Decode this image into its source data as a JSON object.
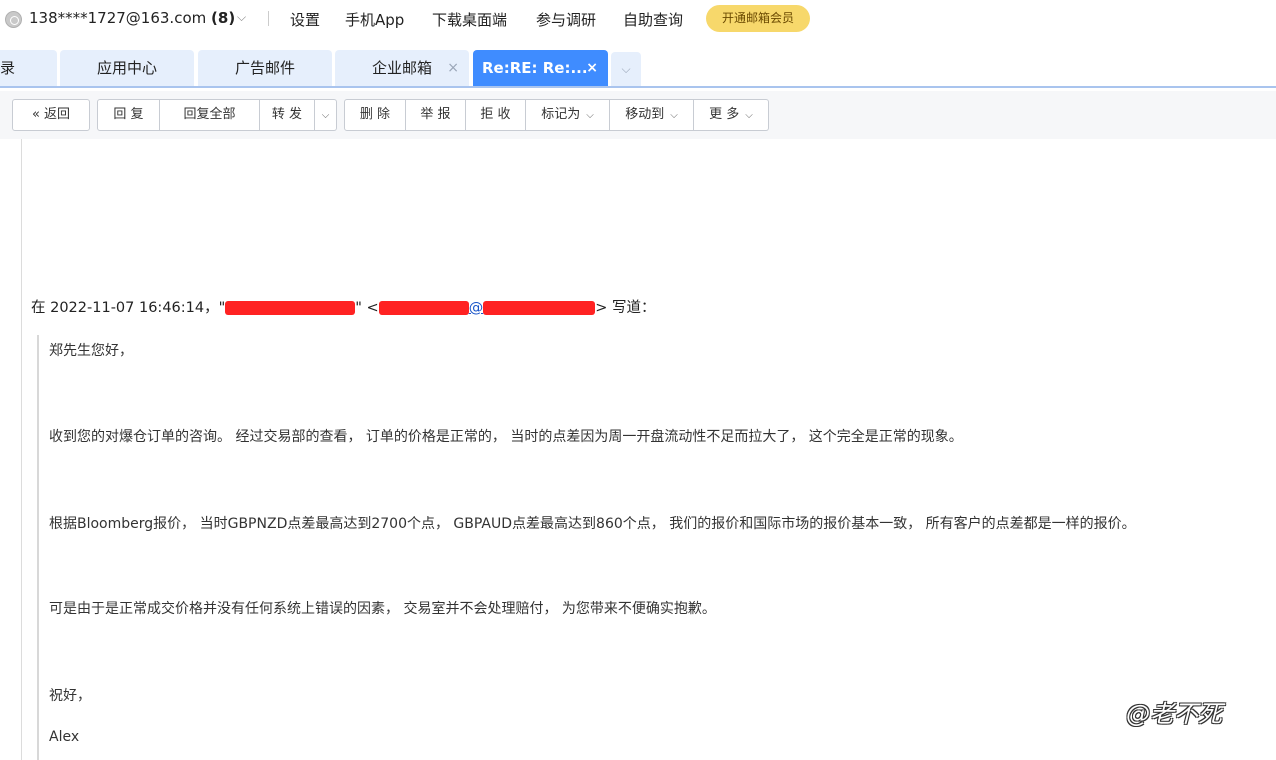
{
  "header": {
    "account_email": "138****1727@163.com",
    "account_unread": "(8)",
    "links": [
      "设置",
      "手机App",
      "下载桌面端",
      "参与调研",
      "自助查询"
    ],
    "vip_label": "开通邮箱会员",
    "vip_color": "#f7d86b"
  },
  "tabs": [
    {
      "label": "录"
    },
    {
      "label": "应用中心"
    },
    {
      "label": "广告邮件"
    },
    {
      "label": "企业邮箱"
    },
    {
      "label": "Re:RE: Re:..."
    }
  ],
  "tab_close_glyph": "×",
  "toolbar": {
    "back": "返回",
    "reply": "回 复",
    "reply_all": "回复全部",
    "forward": "转 发",
    "delete": "删 除",
    "report": "举 报",
    "reject": "拒 收",
    "mark_as": "标记为",
    "move_to": "移动到",
    "more": "更 多"
  },
  "email": {
    "quote_header_prefix": "在 2022-11-07 16:46:14，\"",
    "quote_header_mid": "\" <",
    "quote_header_at": "@",
    "quote_header_suffix": "> 写道：",
    "greeting": "郑先生您好，",
    "para1": "收到您的对爆仓订单的咨询。 经过交易部的查看， 订单的价格是正常的， 当时的点差因为周一开盘流动性不足而拉大了， 这个完全是正常的现象。",
    "para2": "根据Bloomberg报价， 当时GBPNZD点差最高达到2700个点， GBPAUD点差最高达到860个点， 我们的报价和国际市场的报价基本一致， 所有客户的点差都是一样的报价。",
    "para3": "可是由于是正常成交价格并没有任何系统上错误的因素， 交易室并不会处理赔付， 为您带来不便确实抱歉。",
    "closing": "祝好，",
    "signature": "Alex"
  },
  "watermark": "@老不死",
  "colors": {
    "accent": "#3f8cff",
    "tab_bg": "#e6effc",
    "redaction": "#ff2222"
  }
}
